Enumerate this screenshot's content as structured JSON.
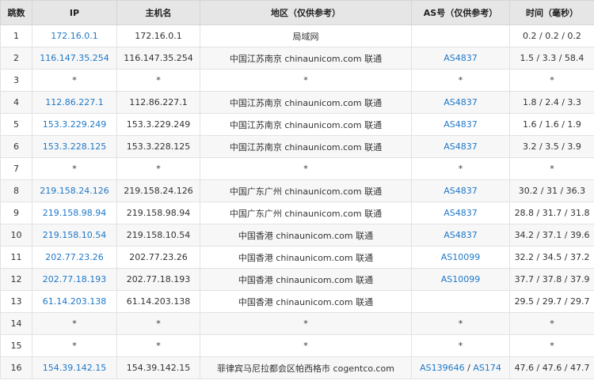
{
  "headers": [
    "跳数",
    "IP",
    "主机名",
    "地区（仅供参考）",
    "AS号（仅供参考）",
    "时间（毫秒）"
  ],
  "rows": [
    {
      "hop": "1",
      "ip": "172.16.0.1",
      "host": "172.16.0.1",
      "region": "局域网",
      "as": [],
      "time": "0.2 / 0.2 / 0.2"
    },
    {
      "hop": "2",
      "ip": "116.147.35.254",
      "host": "116.147.35.254",
      "region": "中国江苏南京 chinaunicom.com 联通",
      "as": [
        "AS4837"
      ],
      "time": "1.5 / 3.3 / 58.4"
    },
    {
      "hop": "3",
      "ip": "*",
      "host": "*",
      "region": "*",
      "as": [
        "*"
      ],
      "time": "*"
    },
    {
      "hop": "4",
      "ip": "112.86.227.1",
      "host": "112.86.227.1",
      "region": "中国江苏南京 chinaunicom.com 联通",
      "as": [
        "AS4837"
      ],
      "time": "1.8 / 2.4 / 3.3"
    },
    {
      "hop": "5",
      "ip": "153.3.229.249",
      "host": "153.3.229.249",
      "region": "中国江苏南京 chinaunicom.com 联通",
      "as": [
        "AS4837"
      ],
      "time": "1.6 / 1.6 / 1.9"
    },
    {
      "hop": "6",
      "ip": "153.3.228.125",
      "host": "153.3.228.125",
      "region": "中国江苏南京 chinaunicom.com 联通",
      "as": [
        "AS4837"
      ],
      "time": "3.2 / 3.5 / 3.9"
    },
    {
      "hop": "7",
      "ip": "*",
      "host": "*",
      "region": "*",
      "as": [
        "*"
      ],
      "time": "*"
    },
    {
      "hop": "8",
      "ip": "219.158.24.126",
      "host": "219.158.24.126",
      "region": "中国广东广州 chinaunicom.com 联通",
      "as": [
        "AS4837"
      ],
      "time": "30.2 / 31 / 36.3"
    },
    {
      "hop": "9",
      "ip": "219.158.98.94",
      "host": "219.158.98.94",
      "region": "中国广东广州 chinaunicom.com 联通",
      "as": [
        "AS4837"
      ],
      "time": "28.8 / 31.7 / 31.8"
    },
    {
      "hop": "10",
      "ip": "219.158.10.54",
      "host": "219.158.10.54",
      "region": "中国香港 chinaunicom.com 联通",
      "as": [
        "AS4837"
      ],
      "time": "34.2 / 37.1 / 39.6"
    },
    {
      "hop": "11",
      "ip": "202.77.23.26",
      "host": "202.77.23.26",
      "region": "中国香港 chinaunicom.com 联通",
      "as": [
        "AS10099"
      ],
      "time": "32.2 / 34.5 / 37.2"
    },
    {
      "hop": "12",
      "ip": "202.77.18.193",
      "host": "202.77.18.193",
      "region": "中国香港 chinaunicom.com 联通",
      "as": [
        "AS10099"
      ],
      "time": "37.7 / 37.8 / 37.9"
    },
    {
      "hop": "13",
      "ip": "61.14.203.138",
      "host": "61.14.203.138",
      "region": "中国香港 chinaunicom.com 联通",
      "as": [],
      "time": "29.5 / 29.7 / 29.7"
    },
    {
      "hop": "14",
      "ip": "*",
      "host": "*",
      "region": "*",
      "as": [
        "*"
      ],
      "time": "*"
    },
    {
      "hop": "15",
      "ip": "*",
      "host": "*",
      "region": "*",
      "as": [
        "*"
      ],
      "time": "*"
    },
    {
      "hop": "16",
      "ip": "154.39.142.15",
      "host": "154.39.142.15",
      "region": "菲律宾马尼拉都会区帕西格市 cogentco.com",
      "as": [
        "AS139646",
        "AS174"
      ],
      "time": "47.6 / 47.6 / 47.7"
    }
  ],
  "as_separator": " / ",
  "colors": {
    "link": "#1e78c8",
    "header_bg": "#e6e6e6",
    "alt_row_bg": "#f7f7f7",
    "border": "#e2e2e2"
  }
}
